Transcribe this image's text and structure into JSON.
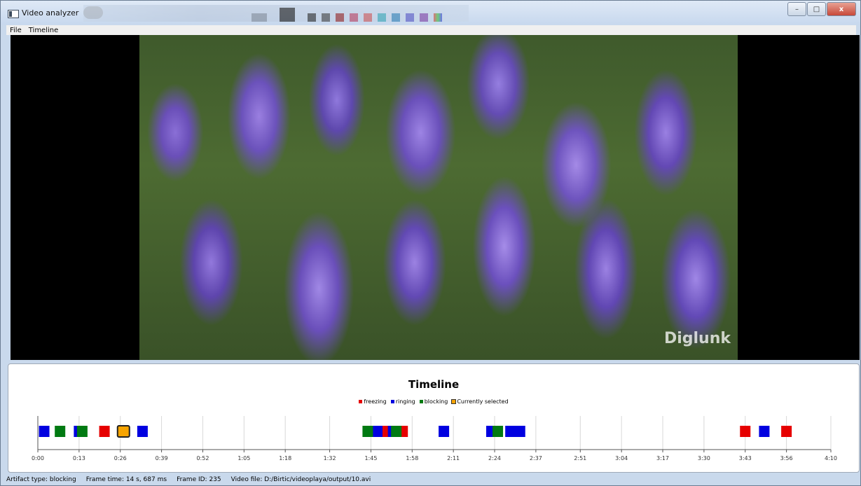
{
  "window": {
    "title": "Video analyzer",
    "buttons": {
      "minimize": "–",
      "maximize": "□",
      "close": "x"
    }
  },
  "menu": {
    "items": [
      {
        "label": "File"
      },
      {
        "label": "Timeline"
      }
    ]
  },
  "video": {
    "watermark": "Diglunk"
  },
  "timeline": {
    "title": "Timeline",
    "legend": [
      {
        "label": "freezing",
        "color": "#e60000"
      },
      {
        "label": "ringing",
        "color": "#0000e0"
      },
      {
        "label": "blocking",
        "color": "#007a12"
      },
      {
        "label": "Currently selected",
        "color": "#f7a400"
      }
    ]
  },
  "chart_data": {
    "type": "scatter",
    "title": "Timeline",
    "x_unit": "seconds",
    "xlim": [
      0,
      250
    ],
    "tick_labels": [
      "0:00",
      "0:13",
      "0:26",
      "0:39",
      "0:52",
      "1:05",
      "1:18",
      "1:32",
      "1:45",
      "1:58",
      "2:11",
      "2:24",
      "2:37",
      "2:51",
      "3:04",
      "3:17",
      "3:30",
      "3:43",
      "3:56",
      "4:10"
    ],
    "tick_seconds": [
      0,
      13,
      26,
      39,
      52,
      65,
      78,
      92,
      105,
      118,
      131,
      144,
      157,
      171,
      184,
      197,
      210,
      223,
      236,
      250
    ],
    "grid": true,
    "legend_position": "top-center",
    "series": [
      {
        "name": "freezing",
        "color": "#e60000",
        "x": [
          21,
          109,
          115,
          150,
          223,
          236
        ]
      },
      {
        "name": "ringing",
        "color": "#0000e0",
        "x": [
          2,
          13,
          33,
          107,
          112,
          128,
          143,
          149,
          152,
          229
        ]
      },
      {
        "name": "blocking",
        "color": "#007a12",
        "x": [
          7,
          14,
          104,
          113,
          145
        ]
      },
      {
        "name": "Currently selected",
        "color": "#f7a400",
        "x": [
          27
        ]
      }
    ]
  },
  "status": {
    "artifact": "Artifact type: blocking",
    "frame_time": "Frame time: 14 s, 687 ms",
    "frame_id": "Frame ID: 235",
    "video_file": "Video file: D:/Birtic/videoplaya/output/10.avi"
  }
}
